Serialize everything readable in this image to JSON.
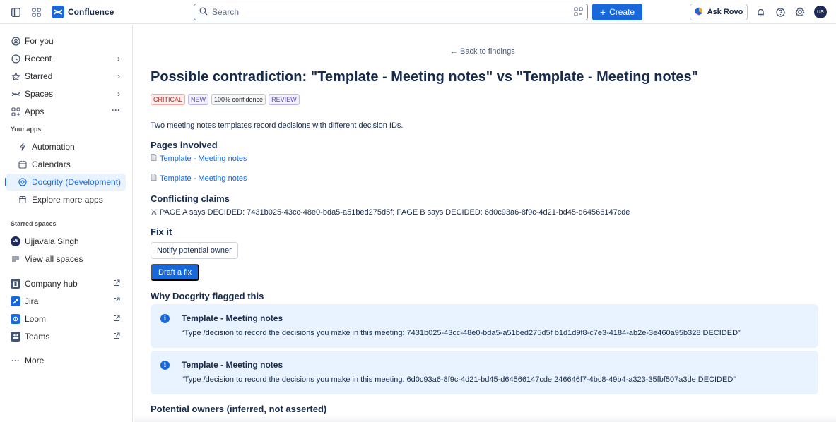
{
  "topbar": {
    "app_name": "Confluence",
    "search_placeholder": "Search",
    "create_label": "Create",
    "ask_rovo_label": "Ask Rovo",
    "avatar_initials": "US"
  },
  "sidebar": {
    "items": [
      {
        "label": "For you",
        "icon": "user-circle-icon"
      },
      {
        "label": "Recent",
        "icon": "clock-icon"
      },
      {
        "label": "Starred",
        "icon": "star-icon"
      },
      {
        "label": "Spaces",
        "icon": "spaces-icon"
      },
      {
        "label": "Apps",
        "icon": "apps-icon"
      }
    ],
    "your_apps_label": "Your apps",
    "apps": [
      {
        "label": "Automation",
        "icon": "lightning-icon"
      },
      {
        "label": "Calendars",
        "icon": "calendar-icon"
      },
      {
        "label": "Docgrity (Development)",
        "icon": "docgrity-icon",
        "active": true
      },
      {
        "label": "Explore more apps",
        "icon": "store-icon"
      }
    ],
    "starred_spaces_label": "Starred spaces",
    "starred_spaces": [
      {
        "label": "Ujjavala Singh",
        "initials": "US"
      },
      {
        "label": "View all spaces",
        "icon": "list-icon"
      }
    ],
    "external": [
      {
        "label": "Company hub",
        "icon": "company-hub-icon"
      },
      {
        "label": "Jira",
        "icon": "jira-icon"
      },
      {
        "label": "Loom",
        "icon": "loom-icon"
      },
      {
        "label": "Teams",
        "icon": "teams-icon"
      }
    ],
    "more_label": "More"
  },
  "main": {
    "back_link": "← Back to findings",
    "title": "Possible contradiction: \"Template - Meeting notes\" vs \"Template - Meeting notes\"",
    "badges": {
      "severity": "CRITICAL",
      "status": "NEW",
      "confidence": "100% confidence",
      "action": "REVIEW"
    },
    "summary": "Two meeting notes templates record decisions with different decision IDs.",
    "pages_heading": "Pages involved",
    "pages": [
      "Template - Meeting notes",
      "Template - Meeting notes"
    ],
    "claims_heading": "Conflicting claims",
    "claims_text": "⚔ PAGE A says DECIDED: 7431b025-43cc-48e0-bda5-a51bed275d5f; PAGE B says DECIDED: 6d0c93a6-8f9c-4d21-bd45-d64566147cde",
    "fix_heading": "Fix it",
    "notify_label": "Notify potential owner",
    "draft_label": "Draft a fix",
    "why_heading": "Why Docgrity flagged this",
    "evidence": [
      {
        "title": "Template - Meeting notes",
        "quote": "“Type /decision to record the decisions you make in this meeting: 7431b025-43cc-48e0-bda5-a51bed275d5f b1d1d9f8-c7e3-4184-ab2e-3e460a95b328 DECIDED”"
      },
      {
        "title": "Template - Meeting notes",
        "quote": "“Type /decision to record the decisions you make in this meeting: 6d0c93a6-8f9c-4d21-bd45-d64566147cde 246646f7-4bc8-49b4-a323-35fbf507a3de DECIDED”"
      }
    ],
    "owners_heading": "Potential owners (inferred, not asserted)"
  }
}
